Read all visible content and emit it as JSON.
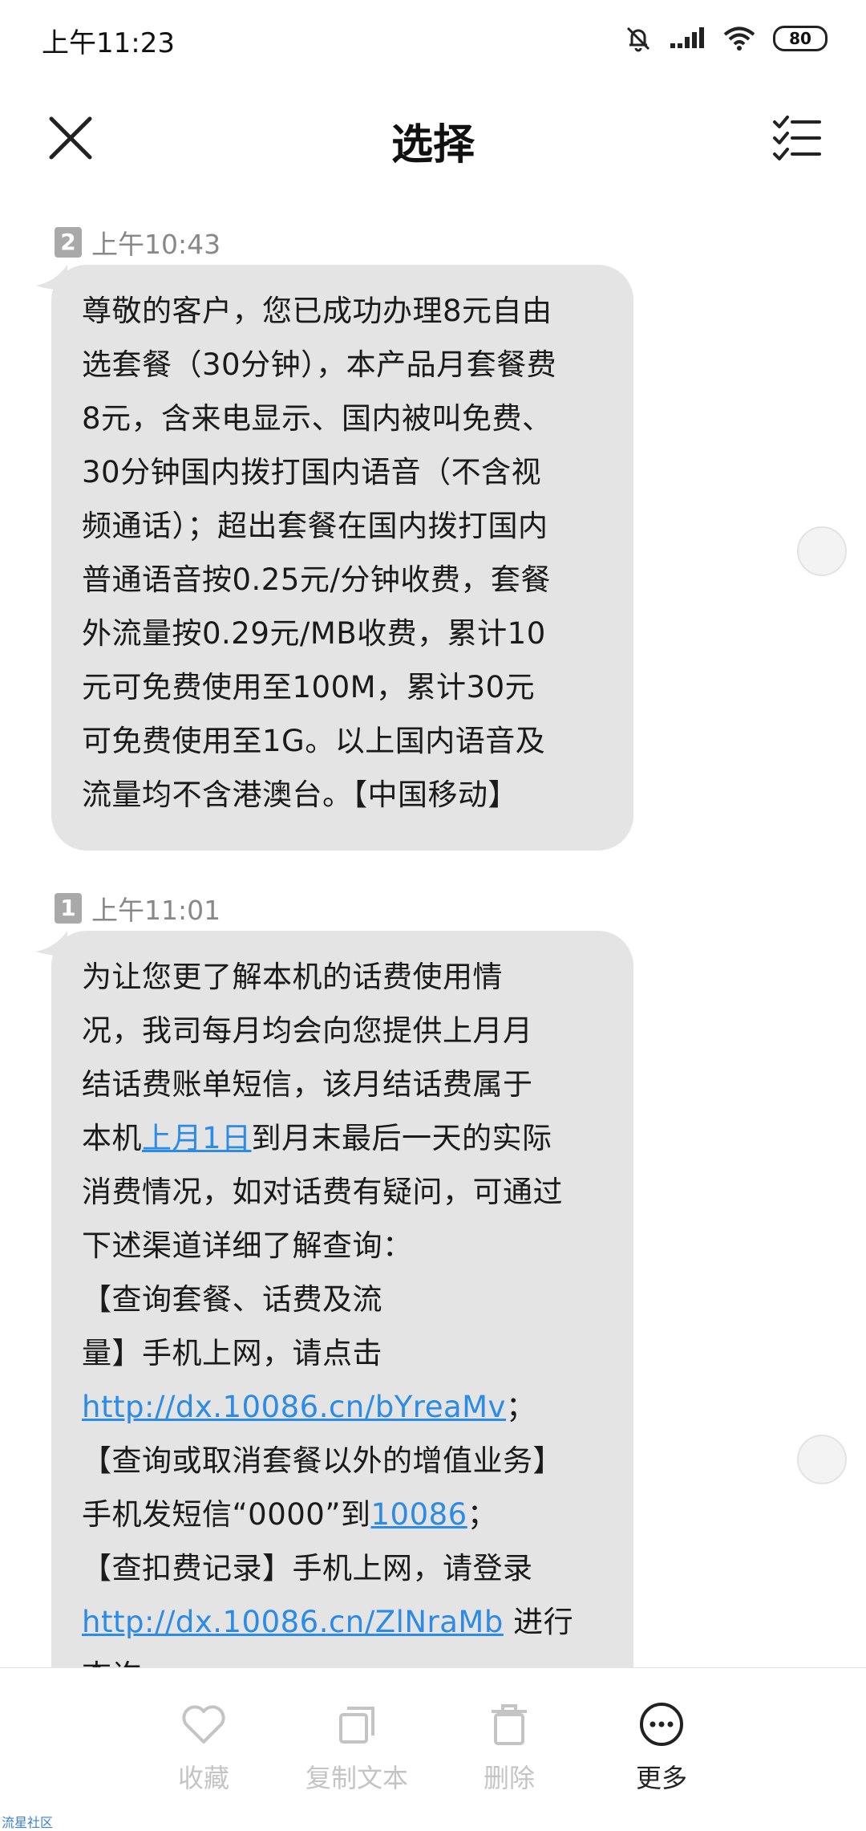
{
  "status_bar": {
    "time": "上午11:23",
    "battery": "80",
    "icons": [
      "mute-bell-icon",
      "signal-icon",
      "wifi-icon",
      "battery-icon"
    ]
  },
  "header": {
    "title": "选择",
    "close_icon": "close-icon",
    "select_all_icon": "checklist-icon"
  },
  "messages": [
    {
      "sim": "2",
      "time": "上午10:43",
      "lines": [
        "尊敬的客户，您已成功办理8元自由",
        "选套餐（30分钟），本产品月套餐费",
        "8元，含来电显示、国内被叫免费、",
        "30分钟国内拨打国内语音（不含视",
        "频通话）；超出套餐在国内拨打国内",
        "普通语音按0.25元/分钟收费，套餐",
        "外流量按0.29元/MB收费，累计10",
        "元可免费使用至100M，累计30元",
        "可免费使用至1G。以上国内语音及",
        "流量均不含港澳台。【中国移动】"
      ]
    },
    {
      "sim": "1",
      "time": "上午11:01",
      "l1": "为让您更了解本机的话费使用情",
      "l2": "况，我司每月均会向您提供上月月",
      "l3": "结话费账单短信，该月结话费属于",
      "l4_pre": "本机",
      "l4_link": "上月1日",
      "l4_post": "到月末最后一天的实际",
      "l5": "消费情况，如对话费有疑问，可通过",
      "l6": "下述渠道详细了解查询：",
      "l7": "【查询套餐、话费及流",
      "l8": "量】手机上网，请点击",
      "l9_link": "http://dx.10086.cn/bYreaMv",
      "l9_post": "；",
      "l10": "【查询或取消套餐以外的增值业务】",
      "l11_pre": "手机发短信“0000”到",
      "l11_link": "10086",
      "l11_post": "；",
      "l12": "【查扣费记录】手机上网，请登录",
      "l13_link": "http://dx.10086.cn/ZlNraMb",
      "l13_post": " 进行",
      "l14": "查询"
    }
  ],
  "actions": [
    {
      "label": "收藏",
      "icon": "heart-icon",
      "active": false
    },
    {
      "label": "复制文本",
      "icon": "copy-icon",
      "active": false
    },
    {
      "label": "删除",
      "icon": "trash-icon",
      "active": false
    },
    {
      "label": "更多",
      "icon": "more-icon",
      "active": true
    }
  ],
  "watermark": "流星社区",
  "colors": {
    "bubble": "#e4e4e4",
    "link": "#2b8be6",
    "disabled": "#c4c4c4"
  }
}
